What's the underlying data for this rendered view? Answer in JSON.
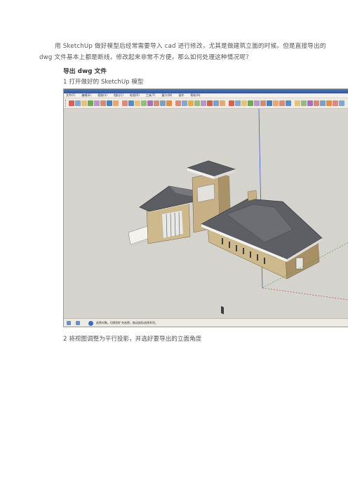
{
  "intro": "用 SketchUp 做好模型后经常需要导入 cad 进行修改，尤其是做建筑立面的时候。但是直接导出的 dwg 文件基本上都是断线，修改起来非常不方便，那么如何处理这种情况呢？",
  "heading": "导出 dwg 文件",
  "step1": "1 打开做好的 SketchUp 模型",
  "step2": "2 将视图调整为平行投影，并选好要导出的立面角度",
  "screenshot": {
    "menu_items": [
      "文件(F)",
      "编辑(E)",
      "视图(V)",
      "相机(C)",
      "绘图(R)",
      "工具(T)",
      "窗口(W)",
      "插件",
      "帮助(H)"
    ],
    "status_text": "选择对象。切换到扩充选择。拖动鼠标选择多项。",
    "toolbar_colors": [
      "#d24a3a",
      "#3f7ac6",
      "#e2a531",
      "#5c9b3f",
      "#9a5bb5",
      "#c44b2b",
      "#2f6fb1",
      "#e37d2d"
    ]
  }
}
